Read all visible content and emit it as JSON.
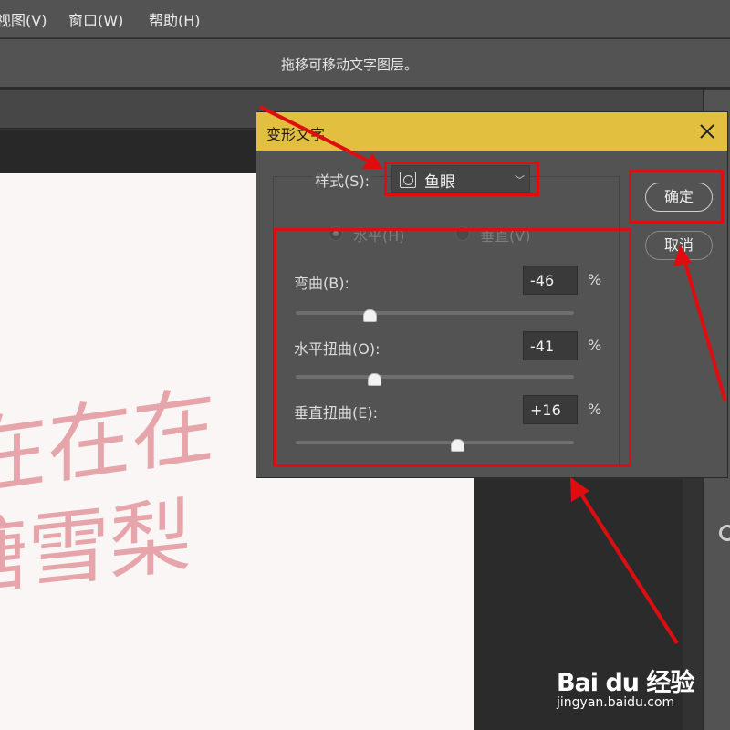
{
  "menubar": {
    "items": [
      {
        "label": "视图(V)"
      },
      {
        "label": "窗口(W)"
      },
      {
        "label": "帮助(H)"
      }
    ]
  },
  "options_bar": {
    "hint": "拖移可移动文字图层。"
  },
  "canvas": {
    "line1": "在在在",
    "line2": "糖雪梨",
    "text_color": "#e6a5ab"
  },
  "dialog": {
    "title": "变形文字",
    "style_label": "样式(S):",
    "style_value": "鱼眼",
    "style_icon": "fisheye-warp-icon",
    "orientation": {
      "horizontal_label": "水平(H)",
      "vertical_label": "垂直(V)",
      "selected": "horizontal"
    },
    "params": [
      {
        "label": "弯曲(B):",
        "value": "-46",
        "unit": "%"
      },
      {
        "label": "水平扭曲(O):",
        "value": "-41",
        "unit": "%"
      },
      {
        "label": "垂直扭曲(E):",
        "value": "+16",
        "unit": "%"
      }
    ],
    "ok_label": "确定",
    "cancel_label": "取消"
  },
  "annotation_color": "#e00d10",
  "titlebar_color": "#e2bf3e",
  "watermark": {
    "main": "Bai du 经验",
    "sub": "jingyan.baidu.com"
  }
}
